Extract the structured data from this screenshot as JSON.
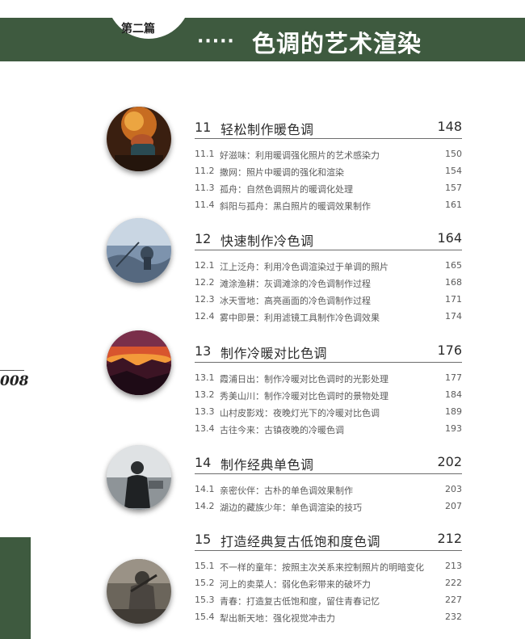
{
  "header": {
    "part_label": "第二篇",
    "dots": "·····",
    "title": "色调的艺术渲染"
  },
  "page_number": "008",
  "chapters": [
    {
      "number": "11",
      "title": "轻松制作暖色调",
      "page": "148",
      "sections": [
        {
          "number": "11.1",
          "title": "好滋味：利用暖调强化照片的艺术感染力",
          "page": "150"
        },
        {
          "number": "11.2",
          "title": "撒网：照片中暖调的强化和渲染",
          "page": "154"
        },
        {
          "number": "11.3",
          "title": "孤舟：自然色调照片的暖调化处理",
          "page": "157"
        },
        {
          "number": "11.4",
          "title": "斜阳与孤舟：黑白照片的暖调效果制作",
          "page": "161"
        }
      ]
    },
    {
      "number": "12",
      "title": "快速制作冷色调",
      "page": "164",
      "sections": [
        {
          "number": "12.1",
          "title": "江上泛舟：利用冷色调渲染过于单调的照片",
          "page": "165"
        },
        {
          "number": "12.2",
          "title": "滩涂渔耕：灰调滩涂的冷色调制作过程",
          "page": "168"
        },
        {
          "number": "12.3",
          "title": "冰天雪地：高亮画面的冷色调制作过程",
          "page": "171"
        },
        {
          "number": "12.4",
          "title": "雾中即景：利用滤镜工具制作冷色调效果",
          "page": "174"
        }
      ]
    },
    {
      "number": "13",
      "title": "制作冷暖对比色调",
      "page": "176",
      "sections": [
        {
          "number": "13.1",
          "title": "霞浦日出：制作冷暖对比色调时的光影处理",
          "page": "177"
        },
        {
          "number": "13.2",
          "title": "秀美山川：制作冷暖对比色调时的景物处理",
          "page": "184"
        },
        {
          "number": "13.3",
          "title": "山村皮影戏：夜晚灯光下的冷暖对比色调",
          "page": "189"
        },
        {
          "number": "13.4",
          "title": "古往今来：古镇夜晚的冷暖色调",
          "page": "193"
        }
      ]
    },
    {
      "number": "14",
      "title": "制作经典单色调",
      "page": "202",
      "sections": [
        {
          "number": "14.1",
          "title": "亲密伙伴：古朴的单色调效果制作",
          "page": "203"
        },
        {
          "number": "14.2",
          "title": "湖边的藏族少年：单色调渲染的技巧",
          "page": "207"
        }
      ]
    },
    {
      "number": "15",
      "title": "打造经典复古低饱和度色调",
      "page": "212",
      "sections": [
        {
          "number": "15.1",
          "title": "不一样的童年：按照主次关系来控制照片的明暗变化",
          "page": "213"
        },
        {
          "number": "15.2",
          "title": "河上的卖菜人：弱化色彩带来的破坏力",
          "page": "222"
        },
        {
          "number": "15.3",
          "title": "青春：打造复古低饱和度，留住青春记忆",
          "page": "227"
        },
        {
          "number": "15.4",
          "title": "犁出新天地：强化视觉冲击力",
          "page": "232"
        }
      ]
    }
  ]
}
